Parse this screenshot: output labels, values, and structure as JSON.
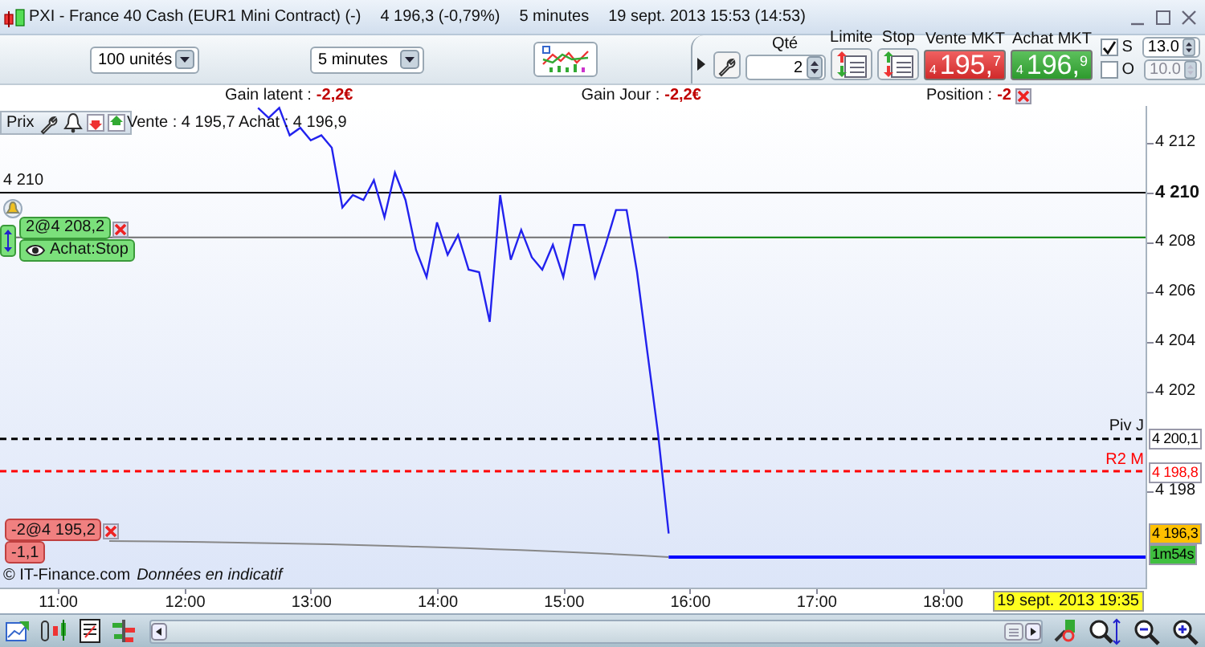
{
  "window": {
    "title": "PXI - France 40 Cash (EUR1 Mini Contract) (-)",
    "quote": "4 196,3 (-0,79%)",
    "period": "5 minutes",
    "time": "19 sept. 2013 15:53 (14:53)"
  },
  "toolbar": {
    "size_select": "100 unités",
    "period_select": "5 minutes"
  },
  "order_panel": {
    "quantity": {
      "label": "Qté",
      "value": "2"
    },
    "limit_label": "Limite",
    "stop_label": "Stop",
    "quotes": [
      {
        "kind": "sell",
        "label": "Vente MKT",
        "prefix": "4",
        "main": "195,",
        "decimal": "7"
      },
      {
        "kind": "buy",
        "label": "Achat MKT",
        "prefix": "4",
        "main": "196,",
        "decimal": "9"
      }
    ],
    "options": [
      {
        "label": "S",
        "checked": true,
        "value": "13.0",
        "disabled": false
      },
      {
        "label": "O",
        "checked": false,
        "value": "10.0",
        "disabled": true
      }
    ]
  },
  "summary": [
    {
      "kind": "gain",
      "label": "Gain latent :",
      "value": "-2,2€"
    },
    {
      "kind": "gain",
      "label": "Gain Jour :",
      "value": "-2,2€"
    },
    {
      "kind": "position",
      "label": "Position :",
      "value": "-2"
    }
  ],
  "chart": {
    "quote": "Vente : 4 195,7 Achat : 4 196,9",
    "credit": "© IT-Finance.com",
    "notice": "Données en indicatif",
    "cursor_time": "19 sept. 2013 19:35",
    "orders": [
      {
        "kind": "buy",
        "text": "2@4 208,2",
        "note": "Achat:Stop"
      },
      {
        "kind": "sell",
        "text": "-2@4 195,2",
        "note": "-1,1"
      }
    ],
    "axis_tags": [
      {
        "kind": "pivot",
        "text": "4 200,1"
      },
      {
        "kind": "resistance",
        "text": "4 198,8"
      },
      {
        "kind": "last",
        "text": "4 196,3"
      },
      {
        "kind": "timer",
        "text": "1m54s"
      }
    ],
    "chart_data": {
      "type": "line",
      "x": [
        755,
        760,
        765,
        770,
        775,
        780,
        785,
        790,
        795,
        800,
        805,
        810,
        815,
        820,
        825,
        830,
        835,
        840,
        845,
        850,
        855,
        860,
        865,
        870,
        875,
        880,
        885,
        890,
        895,
        900,
        905,
        910,
        915,
        920,
        925,
        930,
        935,
        940,
        945,
        950
      ],
      "series": [
        {
          "name": "Prix",
          "color": "#2222ee",
          "values": [
            4213.4,
            4213.0,
            4213.4,
            4212.3,
            4212.6,
            4212.1,
            4212.3,
            4211.8,
            4209.4,
            4209.9,
            4209.7,
            4210.5,
            4209.0,
            4210.8,
            4209.7,
            4207.7,
            4206.6,
            4208.8,
            4207.5,
            4208.3,
            4206.9,
            4206.8,
            4204.8,
            4209.9,
            4207.3,
            4208.5,
            4207.4,
            4206.9,
            4207.9,
            4206.6,
            4208.7,
            4208.7,
            4206.6,
            4207.9,
            4209.3,
            4209.3,
            4206.8,
            4203.5,
            4200.3,
            4196.3
          ]
        }
      ],
      "xlim": [
        632.4,
        1177.3
      ],
      "ylim": [
        4194.06,
        4213.48
      ],
      "xticks": [
        {
          "value": 660,
          "label": "11:00"
        },
        {
          "value": 720,
          "label": "12:00"
        },
        {
          "value": 780,
          "label": "13:00"
        },
        {
          "value": 840,
          "label": "14:00"
        },
        {
          "value": 900,
          "label": "15:00"
        },
        {
          "value": 960,
          "label": "16:00"
        },
        {
          "value": 1020,
          "label": "17:00"
        },
        {
          "value": 1080,
          "label": "18:00"
        }
      ],
      "yticks": [
        {
          "value": 4212,
          "label": "4 212"
        },
        {
          "value": 4210,
          "label": "4 210"
        },
        {
          "value": 4208,
          "label": "4 208"
        },
        {
          "value": 4206,
          "label": "4 206"
        },
        {
          "value": 4204,
          "label": "4 204"
        },
        {
          "value": 4202,
          "label": "4 202"
        },
        {
          "value": 4198,
          "label": "4 198"
        }
      ],
      "ref_lines": [
        {
          "axis": "y",
          "value": 4210,
          "label": "4 210"
        },
        {
          "axis": "y",
          "value": 4208.2
        },
        {
          "axis": "y",
          "value": 4208.2
        },
        {
          "axis": "y",
          "value": 4200.1,
          "label": "Piv J"
        },
        {
          "axis": "y",
          "value": 4198.8,
          "label": "R2 M"
        },
        {
          "axis": "y",
          "value": 4195.35
        }
      ]
    },
    "levels": [
      {
        "kind": "alert"
      },
      {
        "kind": "order"
      },
      {
        "kind": "order_active"
      },
      {
        "kind": "pivot"
      },
      {
        "kind": "resistance"
      },
      {
        "kind": "position"
      }
    ]
  }
}
